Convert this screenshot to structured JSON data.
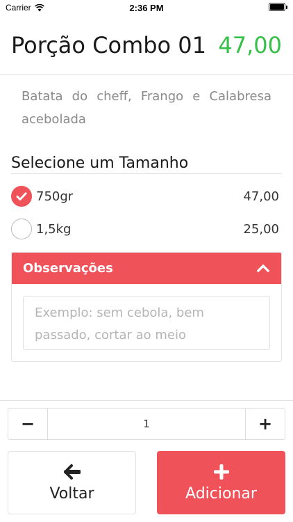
{
  "status_bar": {
    "carrier": "Carrier",
    "time": "2:36 PM"
  },
  "product": {
    "title": "Porção Combo 01",
    "price": "47,00",
    "description": "Batata do cheff, Frango e Calabresa acebolada"
  },
  "sizes": {
    "title": "Selecione um Tamanho",
    "options": [
      {
        "label": "750gr",
        "price": "47,00",
        "selected": true
      },
      {
        "label": "1,5kg",
        "price": "25,00",
        "selected": false
      }
    ]
  },
  "observations": {
    "title": "Observações",
    "placeholder": "Exemplo: sem cebola, bem passado, cortar ao meio"
  },
  "quantity": {
    "minus": "−",
    "value": "1",
    "plus": "+"
  },
  "actions": {
    "back_label": "Voltar",
    "add_label": "Adicionar"
  },
  "colors": {
    "accent": "#f0525a",
    "price": "#36c04a"
  },
  "icons": [
    "wifi-icon",
    "battery-icon",
    "check-icon",
    "chevron-up-icon",
    "arrow-left-icon",
    "plus-icon"
  ]
}
